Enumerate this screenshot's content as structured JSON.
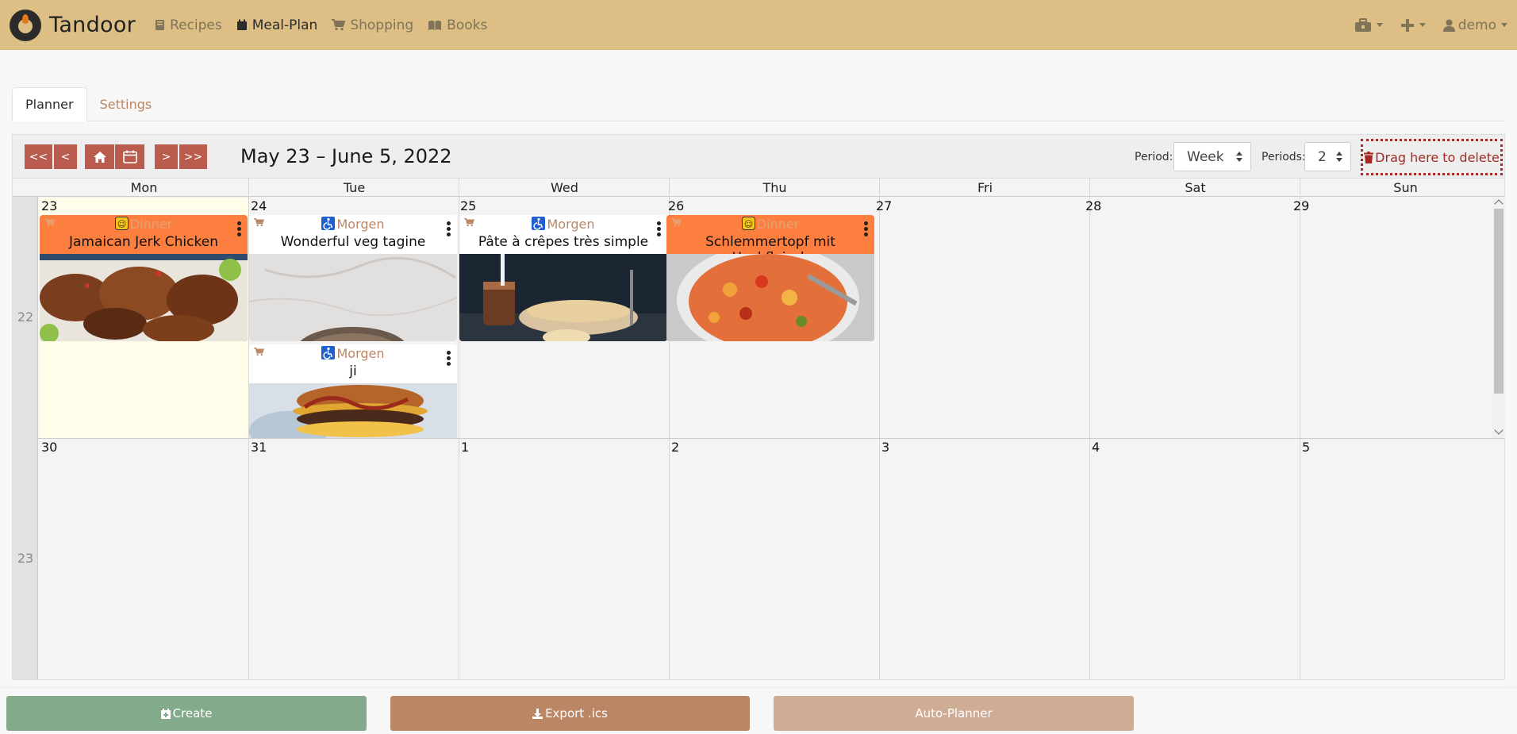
{
  "navbar": {
    "brand": "Tandoor",
    "items": [
      {
        "label": "Recipes",
        "icon": "book-icon"
      },
      {
        "label": "Meal-Plan",
        "icon": "calendar-icon"
      },
      {
        "label": "Shopping",
        "icon": "cart-icon"
      },
      {
        "label": "Books",
        "icon": "open-book-icon"
      }
    ],
    "user": "demo"
  },
  "tabs": [
    "Planner",
    "Settings"
  ],
  "calendar": {
    "range_title": "May 23 – June 5, 2022",
    "nav": {
      "first": "<<",
      "prev": "<",
      "next": ">",
      "last": ">>"
    },
    "period_label": "Period:",
    "period_value": "Week",
    "periods_label": "Periods:",
    "periods_value": "2",
    "delete_zone": "Drag here to delete",
    "day_names": [
      "Mon",
      "Tue",
      "Wed",
      "Thu",
      "Fri",
      "Sat",
      "Sun"
    ],
    "weeks": [
      {
        "number": "22",
        "dates": [
          "23",
          "24",
          "25",
          "26",
          "27",
          "28",
          "29"
        ]
      },
      {
        "number": "23",
        "dates": [
          "30",
          "31",
          "1",
          "2",
          "3",
          "4",
          "5"
        ]
      }
    ],
    "entries": [
      {
        "meal_type": "Dinner",
        "recipe": "Jamaican Jerk Chicken",
        "color": "#fd7f3f"
      },
      {
        "meal_type": "Morgen",
        "recipe": "Wonderful veg tagine",
        "color": "#ffffff"
      },
      {
        "meal_type": "Morgen",
        "recipe": "Pâte à crêpes très simple",
        "color": "#ffffff"
      },
      {
        "meal_type": "Dinner",
        "recipe": "Schlemmertopf mit Hackfleisch",
        "color": "#fd7f3f"
      },
      {
        "meal_type": "Morgen",
        "recipe": "ji",
        "color": "#ffffff"
      }
    ]
  },
  "actions": {
    "create": "Create",
    "export": "Export .ics",
    "auto_planner": "Auto-Planner"
  },
  "colors": {
    "navbar": "#ddbf86",
    "nav_button": "#b95c4e",
    "create": "#82aa8b",
    "export": "#b98766",
    "auto_planner": "#cfac96",
    "delete": "#a62a22"
  }
}
